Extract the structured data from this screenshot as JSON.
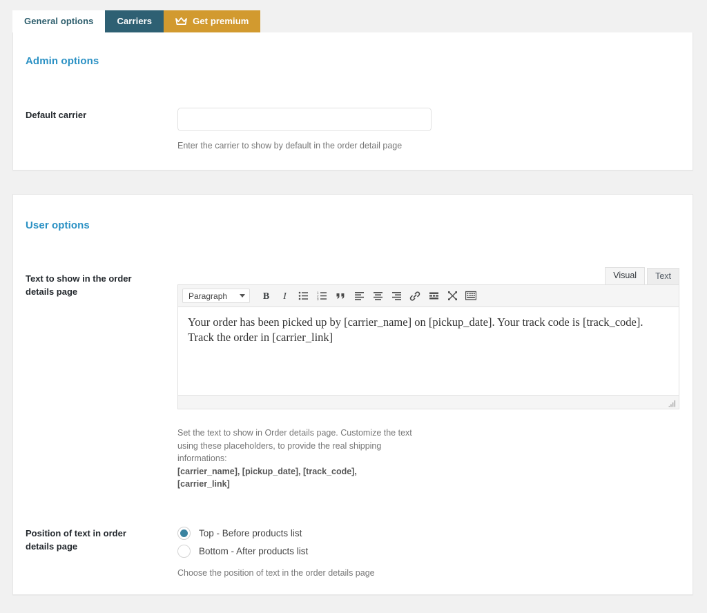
{
  "tabs": [
    {
      "id": "general",
      "label": "General options",
      "state": "active",
      "icon": null
    },
    {
      "id": "carriers",
      "label": "Carriers",
      "state": "inactive",
      "icon": null
    },
    {
      "id": "premium",
      "label": "Get premium",
      "state": "promo",
      "icon": "crown-icon"
    }
  ],
  "colors": {
    "page_background": "#f1f1f1",
    "panel_background": "#ffffff",
    "section_heading": "#2b91c4",
    "tab_active_text": "#2b5c6b",
    "tab_carriers_bg": "#2e6073",
    "tab_premium_bg": "#d29a2f",
    "radio_selected": "#3a83a0"
  },
  "admin_options": {
    "heading": "Admin options",
    "default_carrier": {
      "label": "Default carrier",
      "value": "",
      "placeholder": "",
      "description": "Enter the carrier to show by default in the order detail page"
    }
  },
  "user_options": {
    "heading": "User options",
    "order_text": {
      "label": "Text to show in the order details page",
      "editor": {
        "mode_tabs": [
          {
            "label": "Visual",
            "active": true
          },
          {
            "label": "Text",
            "active": false
          }
        ],
        "format_select": "Paragraph",
        "toolbar_buttons": [
          "bold-icon",
          "italic-icon",
          "bulleted-list-icon",
          "numbered-list-icon",
          "blockquote-icon",
          "align-left-icon",
          "align-center-icon",
          "align-right-icon",
          "link-icon",
          "read-more-icon",
          "fullscreen-icon",
          "toolbar-toggle-icon"
        ],
        "content": "Your order has been picked up by [carrier_name] on [pickup_date]. Your track code is [track_code]. Track the order in [carrier_link]"
      },
      "description_line1": "Set the text to show in Order details page. Customize the",
      "description_line2": "text using these placeholders, to provide the real shipping",
      "description_line3": "informations:",
      "placeholders_line1": "[carrier_name], [pickup_date], [track_code],",
      "placeholders_line2": "[carrier_link]"
    },
    "position": {
      "label": "Position of text in order details page",
      "options": [
        {
          "label": "Top - Before products list",
          "checked": true
        },
        {
          "label": "Bottom - After products list",
          "checked": false
        }
      ],
      "description": "Choose the position of text in the order details page"
    }
  }
}
